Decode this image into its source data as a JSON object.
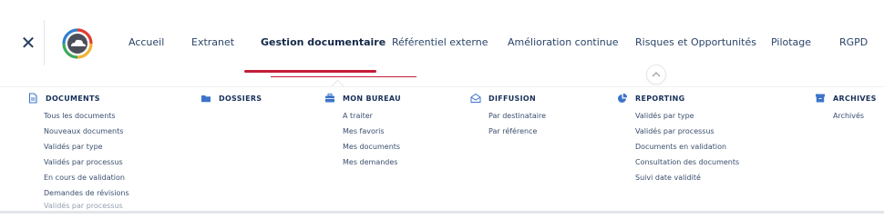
{
  "nav": {
    "items": [
      {
        "label": "Accueil"
      },
      {
        "label": "Extranet"
      },
      {
        "label": "Gestion documentaire"
      },
      {
        "label": "Référentiel externe"
      },
      {
        "label": "Amélioration continue"
      },
      {
        "label": "Risques et Opportunités"
      },
      {
        "label": "Pilotage"
      },
      {
        "label": "RGPD"
      }
    ],
    "active_index": 2,
    "close_icon": "close-icon",
    "accent_color": "#c31d38"
  },
  "menu": {
    "columns": [
      {
        "title": "DOCUMENTS",
        "icon": "document-icon",
        "items": [
          "Tous les documents",
          "Nouveaux documents",
          "Validés par type",
          "Validés par processus",
          "En cours de validation",
          "Demandes de révisions"
        ]
      },
      {
        "title": "DOSSIERS",
        "icon": "folder-icon",
        "items": []
      },
      {
        "title": "MON BUREAU",
        "icon": "briefcase-icon",
        "items": [
          "A traiter",
          "Mes favoris",
          "Mes documents",
          "Mes demandes"
        ]
      },
      {
        "title": "DIFFUSION",
        "icon": "envelope-icon",
        "items": [
          "Par destinataire",
          "Par référence"
        ]
      },
      {
        "title": "REPORTING",
        "icon": "pie-chart-icon",
        "items": [
          "Validés par type",
          "Validés par processus",
          "Documents en validation",
          "Consultation des documents",
          "Suivi date validité"
        ]
      },
      {
        "title": "ARCHIVES",
        "icon": "archive-icon",
        "items": [
          "Archivés"
        ]
      }
    ],
    "overflow_text": "Validés par processus"
  }
}
